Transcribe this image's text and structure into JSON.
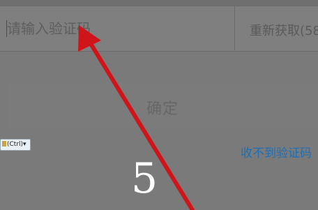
{
  "verification": {
    "input_placeholder": "请输入验证码",
    "resend_label": "重新获取(58"
  },
  "actions": {
    "confirm_label": "确定",
    "help_link": "收不到验证码"
  },
  "overlay": {
    "ctrl_badge": "(Ctrl)▾",
    "step_number": "5",
    "arrow_color": "#d0151a"
  }
}
